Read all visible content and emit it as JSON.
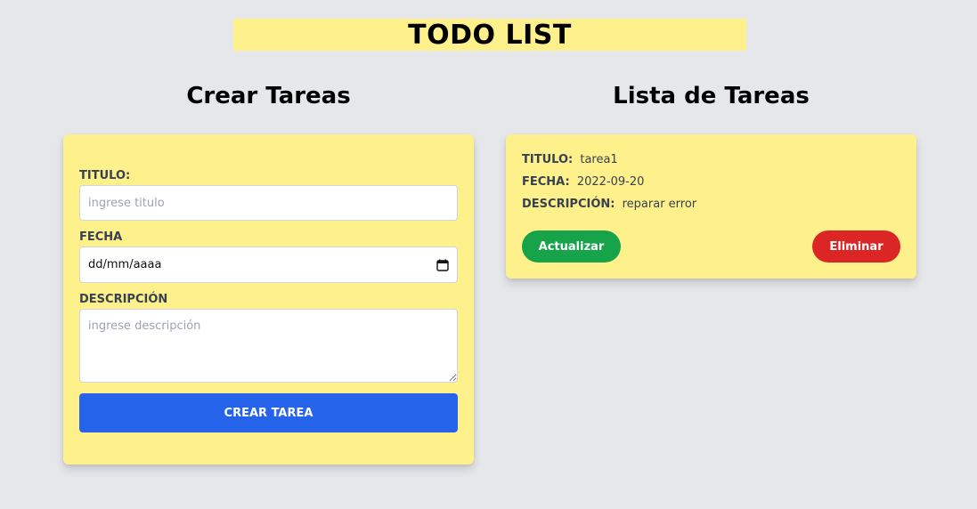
{
  "header": {
    "title": "TODO LIST"
  },
  "create_section": {
    "title": "Crear Tareas",
    "titulo_label": "TITULO:",
    "titulo_placeholder": "ingrese titulo",
    "fecha_label": "FECHA",
    "fecha_value": "dd/mm/aaaa",
    "descripcion_label": "DESCRIPCIÓN",
    "descripcion_placeholder": "ingrese descripción",
    "submit_label": "CREAR TAREA"
  },
  "list_section": {
    "title": "Lista de Tareas",
    "tasks": [
      {
        "titulo_label": "TITULO:",
        "titulo": "tarea1",
        "fecha_label": "FECHA:",
        "fecha": "2022-09-20",
        "descripcion_label": "DESCRIPCIÓN:",
        "descripcion": "reparar error",
        "update_label": "Actualizar",
        "delete_label": "Eliminar"
      }
    ]
  },
  "colors": {
    "background": "#e5e7eb",
    "card": "#fef08a",
    "primary": "#2563eb",
    "success": "#16a34a",
    "danger": "#dc2626"
  },
  "icons": {
    "date_picker": "calendar-icon"
  }
}
